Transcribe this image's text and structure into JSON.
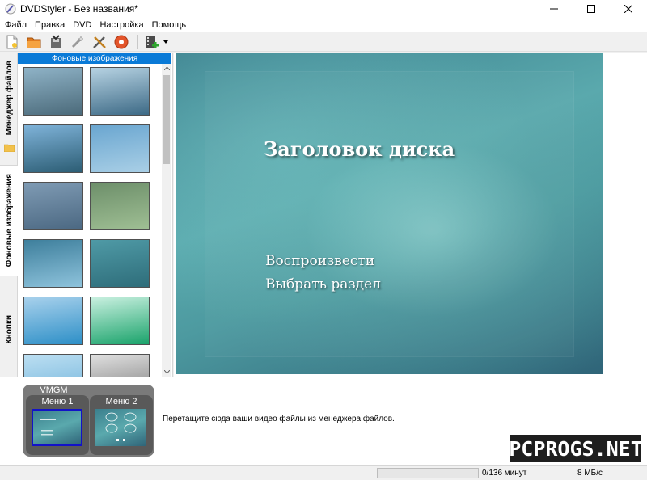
{
  "window": {
    "title": "DVDStyler - Без названия*"
  },
  "menubar": {
    "items": [
      "Файл",
      "Правка",
      "DVD",
      "Настройка",
      "Помощь"
    ]
  },
  "toolbar": {
    "buttons": [
      "new-icon",
      "open-icon",
      "save-icon",
      "wand-icon",
      "settings-icon",
      "burn-icon",
      "add-file-icon"
    ]
  },
  "sidebar": {
    "tabs": [
      {
        "label": "Менеджер файлов",
        "active": false
      },
      {
        "label": "Фоновые изображения",
        "active": true
      },
      {
        "label": "Кнопки",
        "active": false
      }
    ]
  },
  "backgrounds_panel": {
    "header": "Фоновые изображения",
    "thumbnails": [
      {
        "colors": [
          "#8fb3c7",
          "#4b6a7a"
        ]
      },
      {
        "colors": [
          "#b7d3e3",
          "#3d6a86"
        ]
      },
      {
        "colors": [
          "#7fb3d9",
          "#2c5d74"
        ]
      },
      {
        "colors": [
          "#6aa6d0",
          "#a9cfe6"
        ]
      },
      {
        "colors": [
          "#7f9bb4",
          "#4b6882"
        ]
      },
      {
        "colors": [
          "#6d8f6a",
          "#9fbf94"
        ]
      },
      {
        "colors": [
          "#3e7f9c",
          "#8ec3dc"
        ]
      },
      {
        "colors": [
          "#4f9aa6",
          "#2e6d7a"
        ]
      },
      {
        "colors": [
          "#a8d1ec",
          "#2d8fc7"
        ]
      },
      {
        "colors": [
          "#c9f0e0",
          "#1aa36b"
        ]
      },
      {
        "colors": [
          "#bcdff2",
          "#6fb2da"
        ]
      },
      {
        "colors": [
          "#e0e0e0",
          "#7a7a7a"
        ]
      }
    ]
  },
  "preview": {
    "title": "Заголовок диска",
    "buttons": [
      "Воспроизвести",
      "Выбрать раздел"
    ]
  },
  "menus_panel": {
    "group_label": "VMGM",
    "menus": [
      {
        "label": "Меню 1",
        "selected": true
      },
      {
        "label": "Меню 2",
        "selected": false
      }
    ],
    "hint": "Перетащите сюда ваши видео файлы из менеджера файлов."
  },
  "statusbar": {
    "progress": 0,
    "duration": "0/136 минут",
    "rate": "8 МБ/с"
  },
  "watermark": "PCPROGS.NET"
}
